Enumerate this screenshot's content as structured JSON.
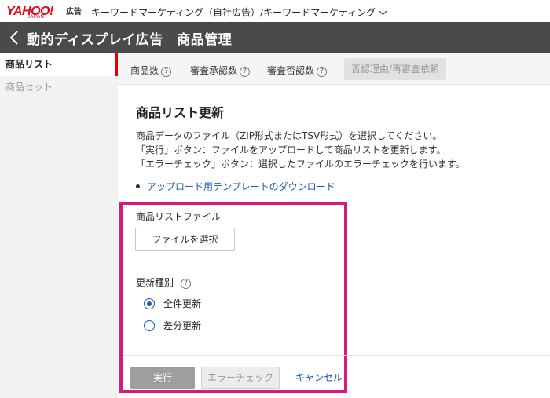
{
  "brand": {
    "logo_text": "YAHOO!",
    "logo_sub": "JAPAN",
    "logo_ad": "広告",
    "brand_color": "#e60012"
  },
  "account": {
    "label": "キーワードマーケティング（自社広告）/キーワードマーケティング",
    "dropdown_icon": "chevron-down-icon"
  },
  "header": {
    "back_icon": "chevron-left-icon",
    "title": "動的ディスプレイ広告　商品管理",
    "background": "#4a4a4a"
  },
  "sidebar": {
    "items": [
      {
        "label": "商品リスト",
        "active": true
      },
      {
        "label": "商品セット",
        "active": false
      }
    ],
    "active_indicator_color": "#e60012"
  },
  "stats": {
    "items": [
      {
        "label": "商品数",
        "value": "-"
      },
      {
        "label": "審査承認数",
        "value": "-"
      },
      {
        "label": "審査否認数",
        "value": "-"
      }
    ],
    "help_icon": "question-circle-icon",
    "reject_button": "否認理由/再審査依頼"
  },
  "main": {
    "title": "商品リスト更新",
    "description": [
      "商品データのファイル（ZIP形式またはTSV形式）を選択してください。",
      "「実行」ボタン：ファイルをアップロードして商品リストを更新します。",
      "「エラーチェック」ボタン：選択したファイルのエラーチェックを行います。"
    ],
    "template_link": "アップロード用テンプレートのダウンロード",
    "link_color": "#1a5ab8"
  },
  "form": {
    "file_label": "商品リストファイル",
    "file_button": "ファイルを選択",
    "type_label": "更新種別",
    "options": [
      {
        "label": "全件更新",
        "selected": true
      },
      {
        "label": "差分更新",
        "selected": false
      }
    ],
    "highlight_color": "#d6197c"
  },
  "actions": {
    "run": "実行",
    "error_check": "エラーチェック",
    "cancel": "キャンセル"
  }
}
